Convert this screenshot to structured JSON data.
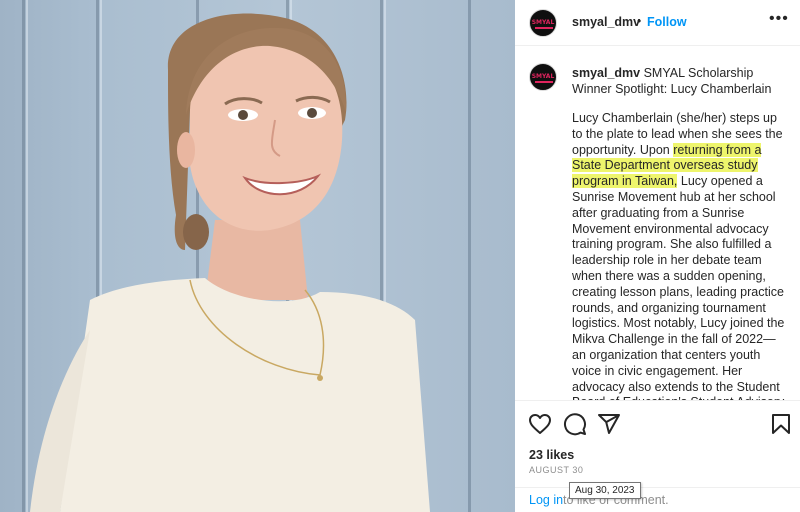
{
  "post": {
    "username": "smyal_dmv",
    "avatar_text": "SMYAL",
    "separator": "•",
    "follow_label": "Follow",
    "more_label": "•••",
    "caption": {
      "username": "smyal_dmv",
      "headline": "SMYAL Scholarship Winner Spotlight: Lucy Chamberlain",
      "body_before": "Lucy Chamberlain (she/her) steps up to the plate to lead when she sees the opportunity. Upon ",
      "body_highlight": "returning from a State Department overseas study program in Taiwan,",
      "body_after": " Lucy opened a Sunrise Movement hub at her school after graduating from a Sunrise Movement environmental advocacy training program. She also fulfilled a leadership role in her debate team when there was a sudden opening, creating lesson plans, leading practice rounds, and organizing tournament logistics. Most notably, Lucy joined the Mikva Challenge in the fall of 2022—an organization that centers youth voice in civic engagement. Her advocacy also extends to the Student Board of Education's Student Advisory"
    },
    "likes": "23 likes",
    "date": "AUGUST 30",
    "date_tooltip": "Aug 30, 2023",
    "footer": {
      "login_label": "Log in",
      "rest": " to like or comment."
    }
  },
  "icons": {
    "like": "heart-icon",
    "comment": "comment-icon",
    "share": "share-icon",
    "save": "bookmark-icon",
    "more": "more-options-icon"
  },
  "colors": {
    "link_blue": "#0095f6",
    "highlight": "#eef56c",
    "muted": "#8e8e8e",
    "text": "#262626"
  }
}
